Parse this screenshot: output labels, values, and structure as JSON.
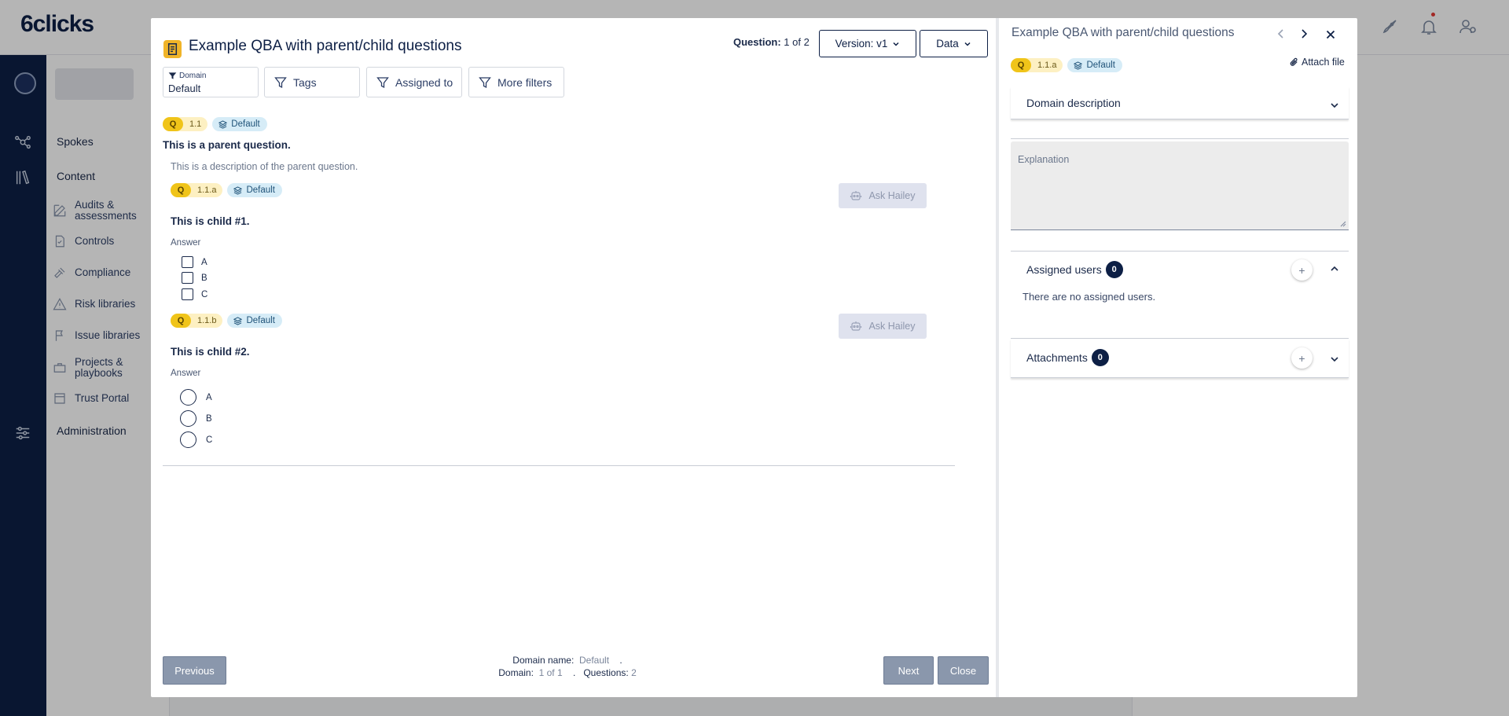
{
  "app": {
    "logo": "6clicks",
    "rail_icons": [
      "profile-avatar",
      "network-icon",
      "library-icon",
      "sliders-icon"
    ],
    "sidebar": {
      "sections": [
        {
          "label": "Spokes"
        },
        {
          "label": "Content"
        },
        {
          "label": "Administration"
        }
      ],
      "items": [
        {
          "label": "Audits & assessments",
          "icon": "pencil-icon"
        },
        {
          "label": "Controls",
          "icon": "check-doc-icon"
        },
        {
          "label": "Compliance",
          "icon": "gavel-icon"
        },
        {
          "label": "Risk libraries",
          "icon": "warning-icon"
        },
        {
          "label": "Issue libraries",
          "icon": "issue-icon"
        },
        {
          "label": "Projects & playbooks",
          "icon": "briefcase-icon"
        },
        {
          "label": "Trust Portal",
          "icon": "portal-icon"
        }
      ]
    },
    "top_icons": [
      "grid-icon",
      "rocket-icon",
      "bell-icon",
      "user-settings-icon"
    ]
  },
  "modal": {
    "title": "Example QBA with parent/child questions",
    "question_counter": {
      "label": "Question:",
      "value": "1 of 2"
    },
    "version_button": "Version: v1",
    "data_button": "Data",
    "filters": {
      "domain": {
        "label": "Domain",
        "value": "Default"
      },
      "tags": "Tags",
      "assigned_to": "Assigned to",
      "more_filters": "More filters"
    },
    "parent": {
      "q_badge": "Q",
      "number": "1.1",
      "domain_tag": "Default",
      "title": "This is a parent question.",
      "description": "This is a description of the parent question."
    },
    "children": [
      {
        "q_badge": "Q",
        "number": "1.1.a",
        "domain_tag": "Default",
        "ask_label": "Ask Hailey",
        "title": "This is child #1.",
        "answer_label": "Answer",
        "options": [
          "A",
          "B",
          "C"
        ]
      },
      {
        "q_badge": "Q",
        "number": "1.1.b",
        "domain_tag": "Default",
        "ask_label": "Ask Hailey",
        "title": "This is child #2.",
        "answer_label": "Answer",
        "options": [
          "A",
          "B",
          "C"
        ]
      }
    ],
    "footer": {
      "previous": "Previous",
      "next": "Next",
      "close": "Close",
      "domain_name_label": "Domain name:",
      "domain_name_value": "Default",
      "domain_label": "Domain:",
      "domain_value": "1 of 1",
      "questions_label": "Questions:",
      "questions_value": "2",
      "sep": "."
    }
  },
  "detail": {
    "title": "Example QBA with parent/child questions",
    "q_badge": "Q",
    "number": "1.1.a",
    "domain_tag": "Default",
    "attach_file": "Attach file",
    "domain_description": "Domain description",
    "explanation_placeholder": "Explanation",
    "assigned_users": {
      "label": "Assigned users",
      "count": "0",
      "empty": "There are no assigned users."
    },
    "attachments": {
      "label": "Attachments",
      "count": "0"
    },
    "plus": "+"
  },
  "colors": {
    "navy": "#0d1f45",
    "q_yellow": "#f0c419",
    "domain_tag_bg": "#d6ecf7",
    "disabled_button": "#8a97ac"
  }
}
